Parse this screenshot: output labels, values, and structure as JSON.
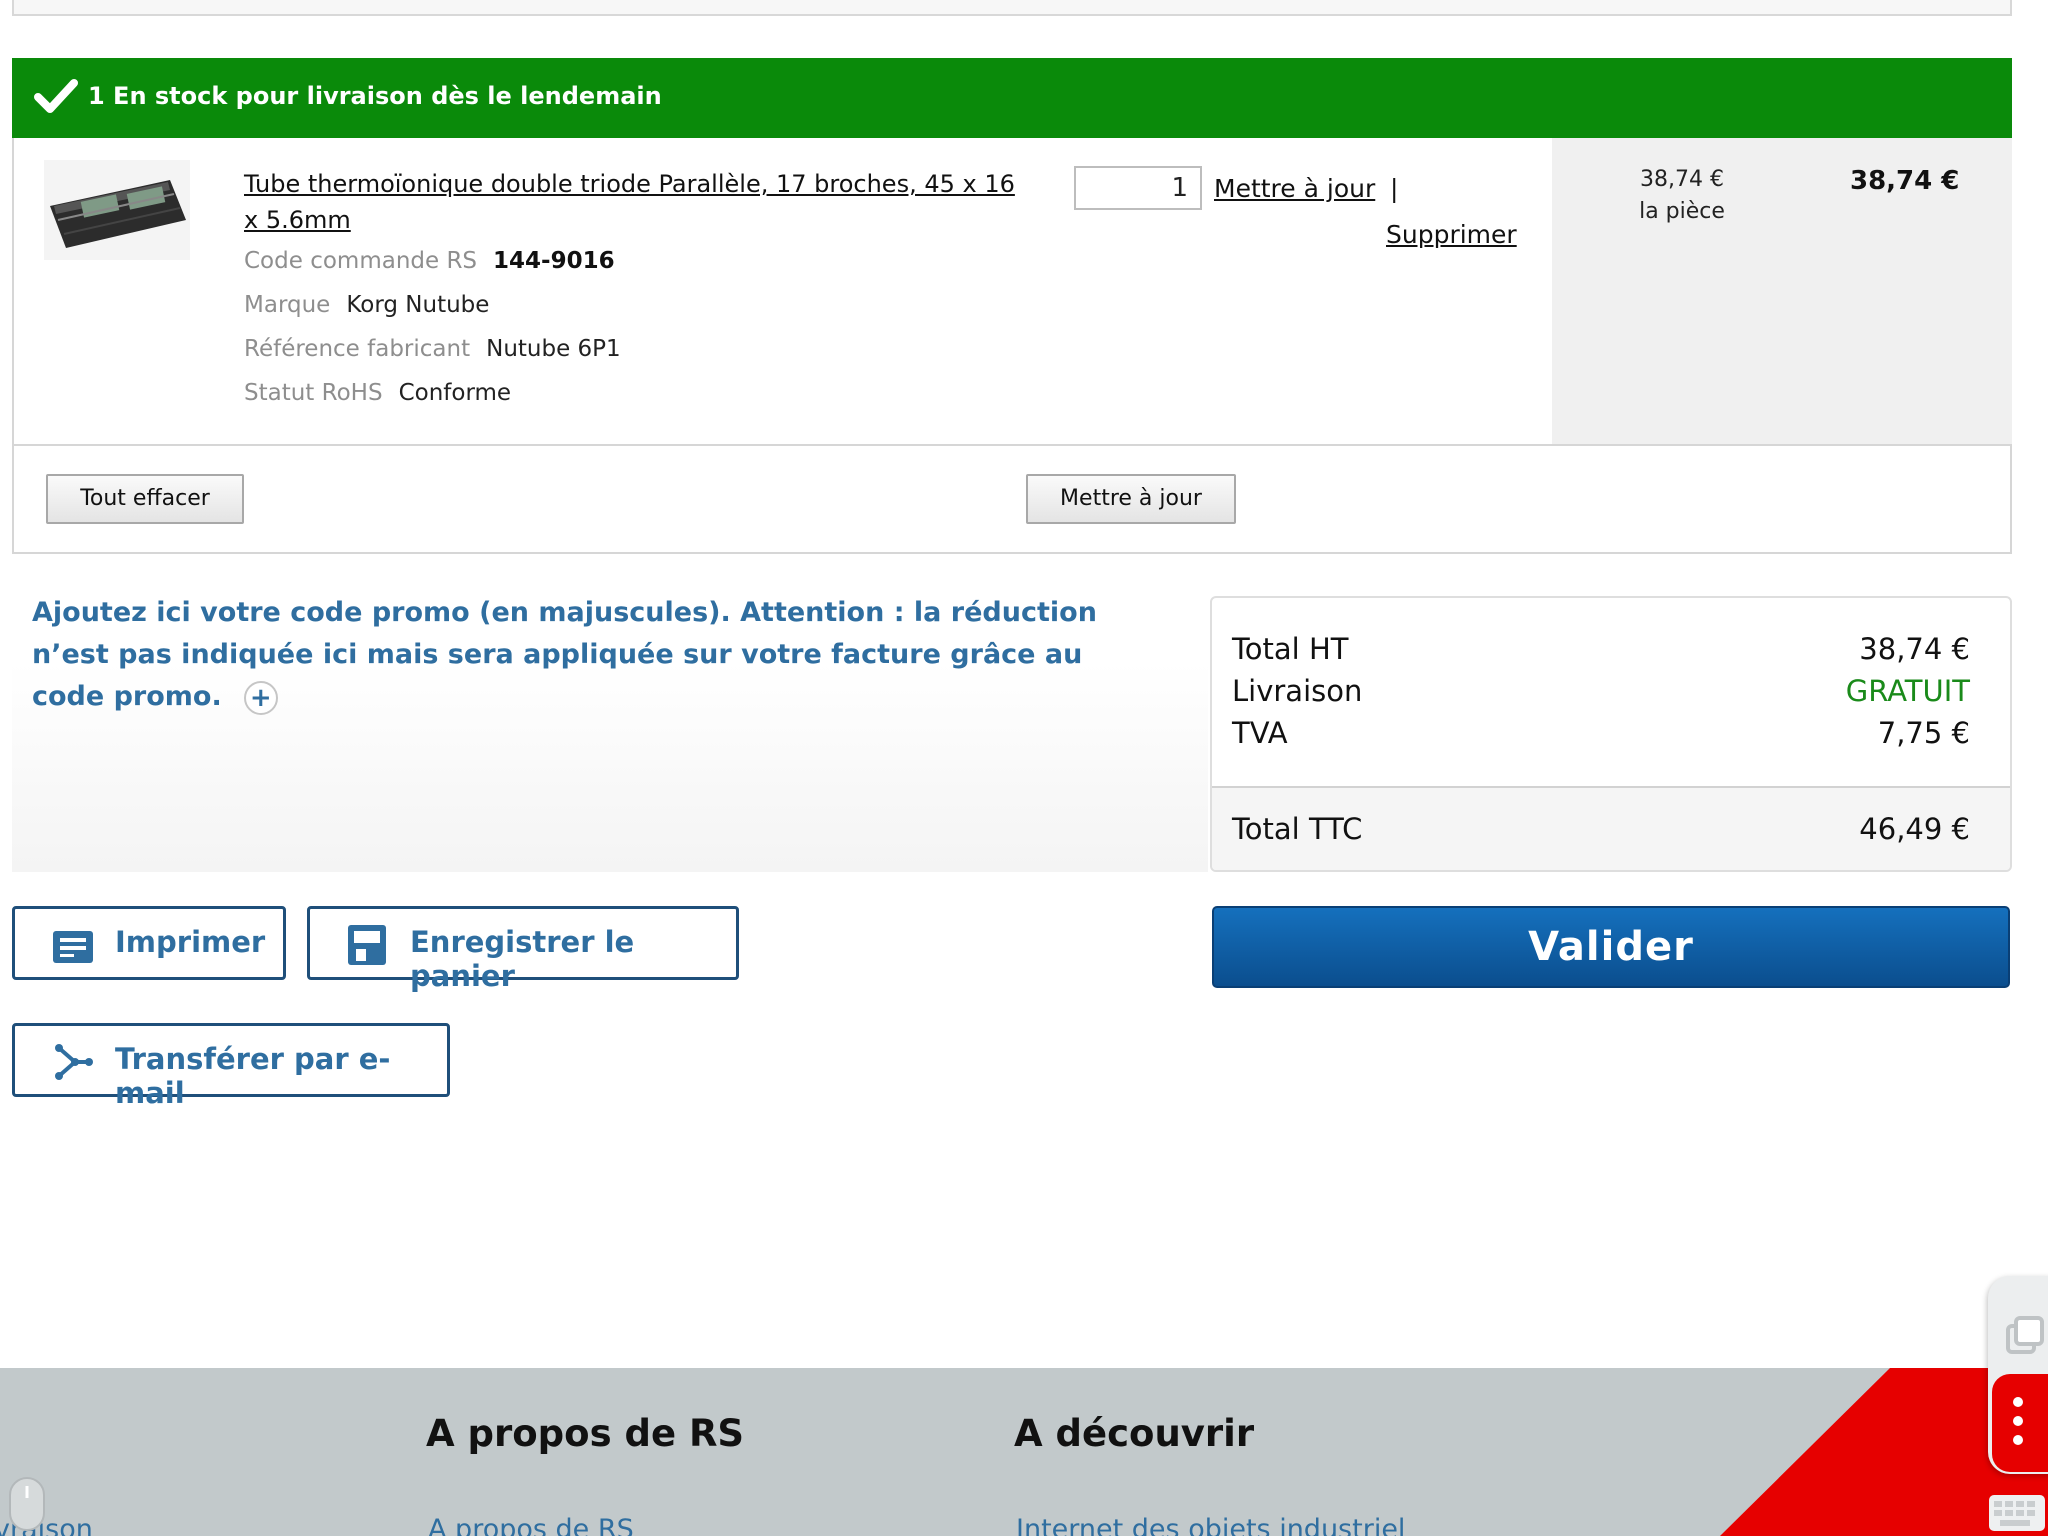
{
  "stock": {
    "label": "1 En stock pour livraison dès le lendemain"
  },
  "item": {
    "title": "Tube thermoïonique double triode Parallèle, 17 broches, 45 x 16 x 5.6mm",
    "specs": [
      {
        "label": "Code commande RS",
        "value": "144-9016"
      },
      {
        "label": "Marque",
        "value": "Korg Nutube"
      },
      {
        "label": "Référence fabricant",
        "value": "Nutube 6P1"
      },
      {
        "label": "Statut RoHS",
        "value": "Conforme"
      }
    ],
    "quantity": "1",
    "update_link": "Mettre à jour",
    "separator": "|",
    "delete_link": "Supprimer",
    "unit_price": "38,74 €",
    "unit_label": "la pièce",
    "line_total": "38,74 €"
  },
  "cart_actions": {
    "clear_all": "Tout effacer",
    "update": "Mettre à jour"
  },
  "promo": {
    "text": "Ajoutez ici votre code promo (en majuscules). Attention : la réduction n’est pas indiquée ici mais sera appliquée sur votre facture grâce au code promo.",
    "expand_symbol": "+"
  },
  "totals": {
    "ht_label": "Total HT",
    "ht_value": "38,74 €",
    "delivery_label": "Livraison",
    "delivery_value": "GRATUIT",
    "tva_label": "TVA",
    "tva_value": "7,75 €",
    "ttc_label": "Total TTC",
    "ttc_value": "46,49 €"
  },
  "buttons": {
    "print": "Imprimer",
    "save_cart": "Enregistrer le panier",
    "email": "Transférer par e-mail",
    "validate": "Valider"
  },
  "footer": {
    "col1_link": "vraison",
    "col2_heading": "A propos de RS",
    "col2_link": "A propos de RS",
    "col3_heading": "A découvrir",
    "col3_link": "Internet des objets industriel"
  },
  "colors": {
    "stock_green": "#0a8a0a",
    "link_blue": "#2f6ea0",
    "free_delivery_green": "#1a8a1a",
    "validate_blue": "#0b5ea8",
    "brand_red": "#e60000",
    "footer_grey": "#c2c9cb"
  },
  "icons": [
    "checkmark-icon",
    "printer-icon",
    "save-icon",
    "share-icon",
    "plus-icon",
    "copy-icon",
    "more-vertical-icon",
    "keyboard-icon",
    "mouse-icon"
  ]
}
